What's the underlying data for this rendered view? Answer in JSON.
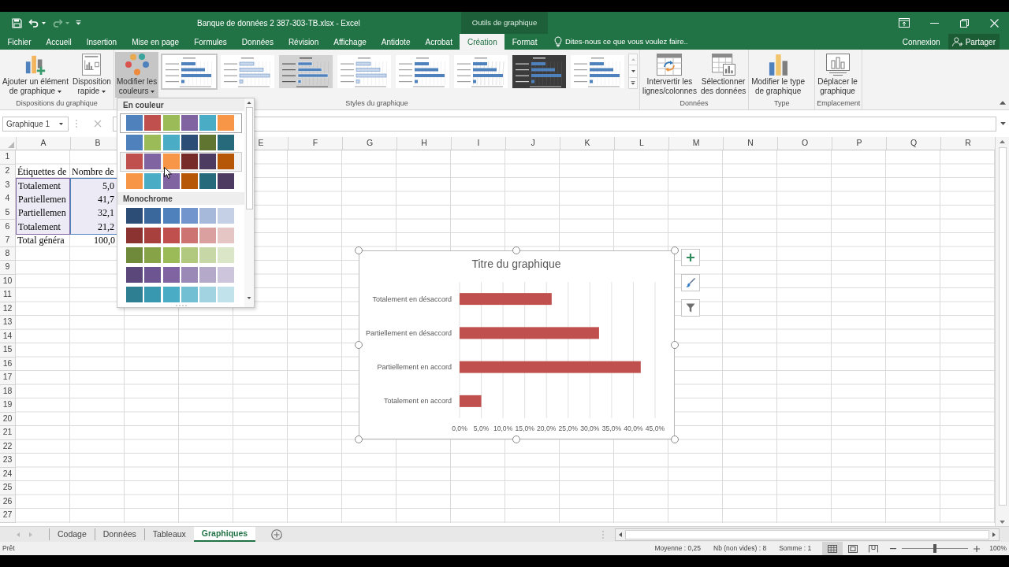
{
  "window": {
    "title": "Banque de données 2 387-303-TB.xlsx - Excel",
    "context_label": "Outils de graphique"
  },
  "quick_access": [
    {
      "kind": "save",
      "disabled": false
    },
    {
      "kind": "undo",
      "disabled": false
    },
    {
      "kind": "redo",
      "disabled": true
    },
    {
      "kind": "customize",
      "disabled": false
    }
  ],
  "ribbon_tabs": [
    {
      "label": "Fichier",
      "selected": false
    },
    {
      "label": "Accueil",
      "selected": false
    },
    {
      "label": "Insertion",
      "selected": false
    },
    {
      "label": "Mise en page",
      "selected": false
    },
    {
      "label": "Formules",
      "selected": false
    },
    {
      "label": "Données",
      "selected": false
    },
    {
      "label": "Révision",
      "selected": false
    },
    {
      "label": "Affichage",
      "selected": false
    },
    {
      "label": "Antidote",
      "selected": false
    },
    {
      "label": "Acrobat",
      "selected": false
    },
    {
      "label": "Création",
      "selected": true
    },
    {
      "label": "Format",
      "selected": false
    }
  ],
  "tell_me": {
    "placeholder": "Dites-nous ce que vous voulez faire.."
  },
  "account": {
    "sign_in": "Connexion",
    "share": "Partager"
  },
  "ribbon_groups": [
    {
      "label": "Dispositions du graphique",
      "buttons": [
        {
          "kind": "add-element",
          "lines": [
            "Ajouter un élément",
            "de graphique"
          ],
          "dropdown": true,
          "pressed": false
        },
        {
          "kind": "quick-layout",
          "lines": [
            "Disposition",
            "rapide"
          ],
          "dropdown": true,
          "pressed": false
        }
      ]
    },
    {
      "label": "Styles du graphique",
      "buttons": [
        {
          "kind": "colors",
          "lines": [
            "Modifier les",
            "couleurs"
          ],
          "dropdown": true,
          "pressed": true
        }
      ],
      "gallery": [
        {
          "kind": "plain",
          "selected": true
        },
        {
          "kind": "outlined",
          "selected": false
        },
        {
          "kind": "shaded",
          "selected": false
        },
        {
          "kind": "outlined",
          "selected": false
        },
        {
          "kind": "plain",
          "selected": false
        },
        {
          "kind": "hatched",
          "selected": false
        },
        {
          "kind": "dark",
          "selected": false
        },
        {
          "kind": "plain",
          "selected": false
        }
      ]
    },
    {
      "label": "Données",
      "buttons": [
        {
          "kind": "switch",
          "lines": [
            "Intervertir les",
            "lignes/colonnes"
          ],
          "dropdown": false,
          "pressed": false
        },
        {
          "kind": "select-data",
          "lines": [
            "Sélectionner",
            "des données"
          ],
          "dropdown": false,
          "pressed": false
        }
      ]
    },
    {
      "label": "Type",
      "buttons": [
        {
          "kind": "chart-type",
          "lines": [
            "Modifier le type",
            "de graphique"
          ],
          "dropdown": false,
          "pressed": false
        }
      ]
    },
    {
      "label": "Emplacement",
      "buttons": [
        {
          "kind": "move",
          "lines": [
            "Déplacer le",
            "graphique"
          ],
          "dropdown": false,
          "pressed": false
        }
      ]
    }
  ],
  "formula_bar": {
    "name_box": "Graphique 1",
    "cancel": {
      "disabled": true
    }
  },
  "color_menu": {
    "sections": [
      {
        "title": "En couleur",
        "palettes": [
          {
            "selected": true,
            "hovered": false,
            "swatches": [
              {
                "color": "#4f81bd"
              },
              {
                "color": "#c0504d"
              },
              {
                "color": "#9bbb59"
              },
              {
                "color": "#8064a2"
              },
              {
                "color": "#4bacc6"
              },
              {
                "color": "#f79646"
              }
            ]
          },
          {
            "selected": false,
            "hovered": false,
            "swatches": [
              {
                "color": "#4f81bd"
              },
              {
                "color": "#9bbb59"
              },
              {
                "color": "#4bacc6"
              },
              {
                "color": "#2c4d75"
              },
              {
                "color": "#5f7530"
              },
              {
                "color": "#276a7c"
              }
            ]
          },
          {
            "selected": false,
            "hovered": true,
            "swatches": [
              {
                "color": "#c0504d"
              },
              {
                "color": "#8064a2"
              },
              {
                "color": "#f79646"
              },
              {
                "color": "#772c2a"
              },
              {
                "color": "#4d3b62"
              },
              {
                "color": "#b65708"
              }
            ]
          },
          {
            "selected": false,
            "hovered": false,
            "swatches": [
              {
                "color": "#f79646"
              },
              {
                "color": "#4bacc6"
              },
              {
                "color": "#8064a2"
              },
              {
                "color": "#b65708"
              },
              {
                "color": "#276a7c"
              },
              {
                "color": "#4d3b62"
              }
            ]
          }
        ]
      },
      {
        "title": "Monochrome",
        "palettes": [
          {
            "selected": false,
            "hovered": false,
            "swatches": [
              {
                "color": "#2c4d75"
              },
              {
                "color": "#3a679c"
              },
              {
                "color": "#4f81bd"
              },
              {
                "color": "#7395cd"
              },
              {
                "color": "#a7b9da"
              },
              {
                "color": "#c5d0e6"
              }
            ]
          },
          {
            "selected": false,
            "hovered": false,
            "swatches": [
              {
                "color": "#8b3331"
              },
              {
                "color": "#a8403d"
              },
              {
                "color": "#c0504d"
              },
              {
                "color": "#cd7371"
              },
              {
                "color": "#d9a09f"
              },
              {
                "color": "#e6c6c5"
              }
            ]
          },
          {
            "selected": false,
            "hovered": false,
            "swatches": [
              {
                "color": "#6f8a3a"
              },
              {
                "color": "#86a447"
              },
              {
                "color": "#9bbb59"
              },
              {
                "color": "#b0c97e"
              },
              {
                "color": "#c7d8a6"
              },
              {
                "color": "#dbe6c8"
              }
            ]
          },
          {
            "selected": false,
            "hovered": false,
            "swatches": [
              {
                "color": "#5b477a"
              },
              {
                "color": "#6d5592"
              },
              {
                "color": "#8064a2"
              },
              {
                "color": "#9a88b6"
              },
              {
                "color": "#b5a9ca"
              },
              {
                "color": "#cdc5dc"
              }
            ]
          },
          {
            "selected": false,
            "hovered": false,
            "swatches": [
              {
                "color": "#2f7f93"
              },
              {
                "color": "#3898b0"
              },
              {
                "color": "#4bacc6"
              },
              {
                "color": "#72bfd3"
              },
              {
                "color": "#a1d3e1"
              },
              {
                "color": "#c2e2eb"
              }
            ]
          }
        ]
      }
    ]
  },
  "sheet": {
    "column_headers_left": [
      "A",
      "B"
    ],
    "column_headers_right": [
      "E",
      "F",
      "G",
      "H",
      "I",
      "J",
      "K",
      "L",
      "M",
      "N",
      "O",
      "P",
      "Q",
      "R"
    ],
    "rows": [
      {
        "number": "1"
      },
      {
        "number": "2",
        "cells": [
          {
            "text": "Étiquettes de",
            "kind": "text"
          },
          {
            "text": "Nombre de",
            "kind": "text"
          }
        ]
      },
      {
        "number": "3",
        "cells": [
          {
            "text": "Totalement",
            "kind": "text",
            "color": "#8064a2"
          },
          {
            "text": "5,0",
            "kind": "number",
            "color": "#4f81bd"
          }
        ]
      },
      {
        "number": "4",
        "cells": [
          {
            "text": "Partiellemen",
            "kind": "text",
            "color": "#8064a2"
          },
          {
            "text": "41,7",
            "kind": "number",
            "color": "#4f81bd"
          }
        ]
      },
      {
        "number": "5",
        "cells": [
          {
            "text": "Partiellemen",
            "kind": "text",
            "color": "#8064a2"
          },
          {
            "text": "32,1",
            "kind": "number",
            "color": "#4f81bd"
          }
        ]
      },
      {
        "number": "6",
        "cells": [
          {
            "text": "Totalement",
            "kind": "text",
            "color": "#8064a2"
          },
          {
            "text": "21,2",
            "kind": "number",
            "color": "#4f81bd"
          }
        ]
      },
      {
        "number": "7",
        "cells": [
          {
            "text": "Total généra",
            "kind": "text"
          },
          {
            "text": "100,0",
            "kind": "number"
          }
        ]
      },
      {
        "number": "8"
      },
      {
        "number": "9"
      },
      {
        "number": "10"
      },
      {
        "number": "11"
      },
      {
        "number": "12"
      },
      {
        "number": "13"
      },
      {
        "number": "14"
      },
      {
        "number": "15"
      },
      {
        "number": "16"
      },
      {
        "number": "17"
      },
      {
        "number": "18"
      },
      {
        "number": "19"
      },
      {
        "number": "20"
      },
      {
        "number": "21"
      },
      {
        "number": "22"
      },
      {
        "number": "23"
      },
      {
        "number": "24"
      },
      {
        "number": "25"
      },
      {
        "number": "26"
      },
      {
        "number": "27"
      }
    ]
  },
  "chart": {
    "selected": true,
    "chart_data": [
      {
        "type": "bar",
        "orientation": "horizontal",
        "title": "Titre du graphique",
        "categories": [
          "Totalement en désaccord",
          "Partiellement en désaccord",
          "Partiellement en accord",
          "Totalement en accord"
        ],
        "values": [
          21.2,
          32.1,
          41.7,
          5.0
        ],
        "color": "#c0504d",
        "xlim": [
          0,
          45
        ],
        "xticks": [
          {
            "value": 0,
            "label": "0,0%"
          },
          {
            "value": 5,
            "label": "5,0%"
          },
          {
            "value": 10,
            "label": "10,0%"
          },
          {
            "value": 15,
            "label": "15,0%"
          },
          {
            "value": 20,
            "label": "20,0%"
          },
          {
            "value": 25,
            "label": "25,0%"
          },
          {
            "value": 30,
            "label": "30,0%"
          },
          {
            "value": 35,
            "label": "35,0%"
          },
          {
            "value": 40,
            "label": "40,0%"
          },
          {
            "value": 45,
            "label": "45,0%"
          }
        ],
        "grid": true
      }
    ]
  },
  "sheet_tabs": [
    {
      "label": "Codage",
      "selected": false
    },
    {
      "label": "Données",
      "selected": false
    },
    {
      "label": "Tableaux",
      "selected": false
    },
    {
      "label": "Graphiques",
      "selected": true
    }
  ],
  "status_bar": {
    "mode": "Prêt",
    "stats": [
      "Moyenne : 0,25",
      "Nb (non vides) : 8",
      "Somme : 1"
    ],
    "views": [
      {
        "kind": "normal",
        "selected": true
      },
      {
        "kind": "page-layout",
        "selected": false
      },
      {
        "kind": "page-break",
        "selected": false
      }
    ],
    "zoom": {
      "level": 0.5,
      "reading": "100%"
    }
  }
}
